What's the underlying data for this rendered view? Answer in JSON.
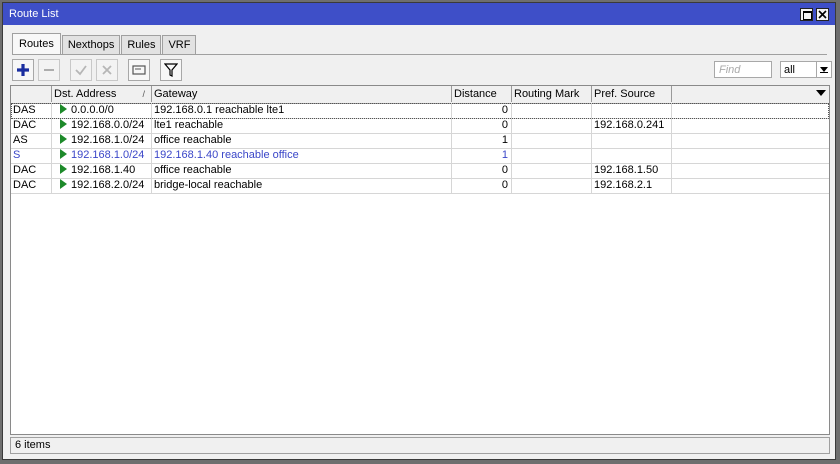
{
  "window": {
    "title": "Route List"
  },
  "tabs": [
    {
      "label": "Routes",
      "active": true
    },
    {
      "label": "Nexthops",
      "active": false
    },
    {
      "label": "Rules",
      "active": false
    },
    {
      "label": "VRF",
      "active": false
    }
  ],
  "toolbar": {
    "find_placeholder": "Find",
    "filter_select_value": "all",
    "icons": [
      "plus-icon",
      "minus-icon",
      "check-icon",
      "cross-icon",
      "comment-icon",
      "filter-icon"
    ]
  },
  "table": {
    "columns": [
      {
        "key": "flags",
        "label": ""
      },
      {
        "key": "dst",
        "label": "Dst. Address",
        "sort": "/"
      },
      {
        "key": "gateway",
        "label": "Gateway"
      },
      {
        "key": "distance",
        "label": "Distance"
      },
      {
        "key": "mark",
        "label": "Routing Mark"
      },
      {
        "key": "pref",
        "label": "Pref. Source"
      },
      {
        "key": "extra",
        "label": ""
      }
    ],
    "rows": [
      {
        "flags": "DAS",
        "dst": "0.0.0.0/0",
        "gateway": "192.168.0.1 reachable lte1",
        "distance": "0",
        "mark": "",
        "pref": "",
        "selected": true,
        "static": false
      },
      {
        "flags": "DAC",
        "dst": "192.168.0.0/24",
        "gateway": "lte1 reachable",
        "distance": "0",
        "mark": "",
        "pref": "192.168.0.241",
        "selected": false,
        "static": false
      },
      {
        "flags": "AS",
        "dst": "192.168.1.0/24",
        "gateway": "office reachable",
        "distance": "1",
        "mark": "",
        "pref": "",
        "selected": false,
        "static": false
      },
      {
        "flags": "S",
        "dst": "192.168.1.0/24",
        "gateway": "192.168.1.40 reachable office",
        "distance": "1",
        "mark": "",
        "pref": "",
        "selected": false,
        "static": true
      },
      {
        "flags": "DAC",
        "dst": "192.168.1.40",
        "gateway": "office reachable",
        "distance": "0",
        "mark": "",
        "pref": "192.168.1.50",
        "selected": false,
        "static": false
      },
      {
        "flags": "DAC",
        "dst": "192.168.2.0/24",
        "gateway": "bridge-local reachable",
        "distance": "0",
        "mark": "",
        "pref": "192.168.2.1",
        "selected": false,
        "static": false
      }
    ]
  },
  "status": {
    "text": "6 items"
  },
  "colors": {
    "titlebar": "#3e4fc8",
    "static_row": "#3a46c8",
    "active_flag": "#1d8a2a",
    "add_icon": "#1a2ea0"
  }
}
